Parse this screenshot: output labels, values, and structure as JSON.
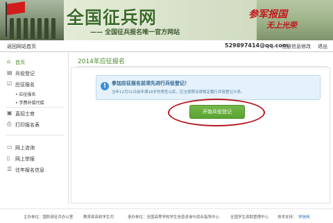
{
  "banner": {
    "title": "全国征兵网",
    "subtitle": "—— 全国征兵报名唯一官方网站",
    "slogan_line1": "参军报国",
    "slogan_line2": "无上光荣"
  },
  "topbar": {
    "back_link": "返回网站首页",
    "user_email": "529897414@qq.com",
    "register_info": "注册信息修改",
    "logout": "退出"
  },
  "sidebar": {
    "items": [
      {
        "label": "首页",
        "icon": "home-icon"
      },
      {
        "label": "兵役登记",
        "icon": "document-icon"
      },
      {
        "label": "应征报名",
        "icon": "checkbox-icon"
      },
      {
        "label": "应征报名",
        "sub": true
      },
      {
        "label": "学费补偿代偿",
        "sub": true
      },
      {
        "label": "直招士官",
        "icon": "id-card-icon"
      },
      {
        "label": "打印报名表",
        "icon": "printer-icon"
      },
      {
        "label": "网上咨询",
        "icon": "chat-icon"
      },
      {
        "label": "网上举报",
        "icon": "report-icon"
      },
      {
        "label": "往年报名信息",
        "icon": "list-icon"
      }
    ]
  },
  "main": {
    "title": "2014年应征报名",
    "notice_title": "参加应征报名前须先进行兵役登记！",
    "notice_text": "当年12月31日前年满18岁的男性公民，应当按照法律规定履行兵役登记义务。",
    "start_button": "开始兵役登记"
  },
  "footer": {
    "host": "主办单位：国防部征兵办公室",
    "host2": "教育部高校学生司",
    "organizer": "承办单位：全国高等学校学生信息咨询与就业指导中心",
    "organizer2": "全国学生资助管理中心",
    "support_label": "技术支持：",
    "support_value": "学信网"
  },
  "colors": {
    "accent_green": "#4b8a2a",
    "button_green": "#5aa332",
    "notice_bg": "#e5f2fb",
    "highlight_red": "#b4171e"
  }
}
